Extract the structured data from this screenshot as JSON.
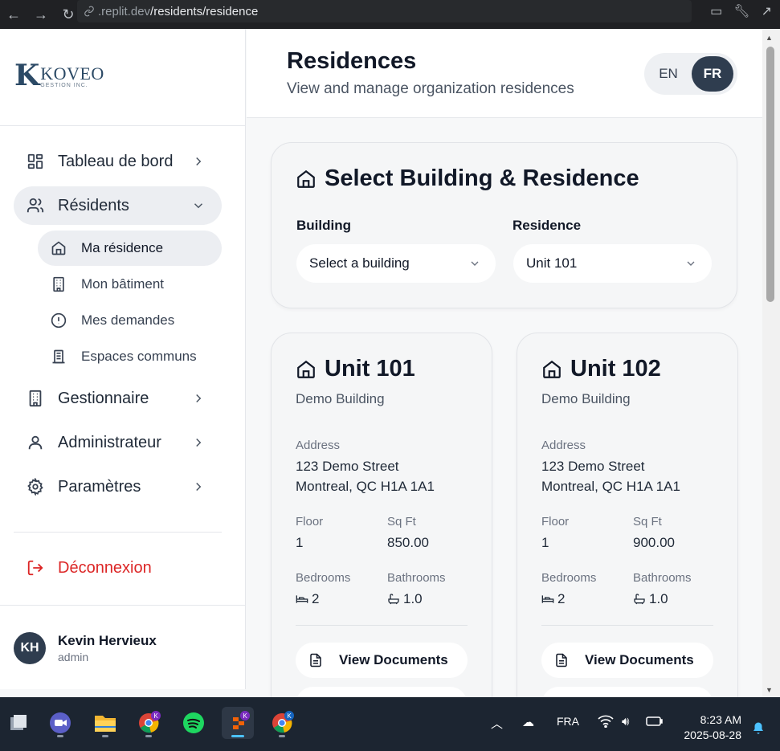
{
  "browser": {
    "url_host": ".replit.dev",
    "url_path": "/residents/residence"
  },
  "sidebar": {
    "logo": {
      "mark": "K",
      "name": "KOVEO",
      "sub": "GESTION INC."
    },
    "items": [
      {
        "label": "Tableau de bord",
        "icon": "dashboard-icon"
      },
      {
        "label": "Résidents",
        "icon": "users-icon"
      },
      {
        "label": "Gestionnaire",
        "icon": "building-icon"
      },
      {
        "label": "Administrateur",
        "icon": "user-icon"
      },
      {
        "label": "Paramètres",
        "icon": "gear-icon"
      }
    ],
    "sub_items": [
      {
        "label": "Ma résidence",
        "icon": "home-icon"
      },
      {
        "label": "Mon bâtiment",
        "icon": "building-icon"
      },
      {
        "label": "Mes demandes",
        "icon": "alert-circle-icon"
      },
      {
        "label": "Espaces communs",
        "icon": "library-icon"
      }
    ],
    "logout_label": "Déconnexion",
    "user": {
      "initials": "KH",
      "name": "Kevin Hervieux",
      "role": "admin"
    }
  },
  "header": {
    "title": "Residences",
    "subtitle": "View and manage organization residences",
    "lang_en": "EN",
    "lang_fr": "FR"
  },
  "selector": {
    "title": "Select Building & Residence",
    "building_label": "Building",
    "building_value": "Select a building",
    "residence_label": "Residence",
    "residence_value": "Unit 101"
  },
  "units": [
    {
      "name": "Unit 101",
      "building": "Demo Building",
      "address_label": "Address",
      "address_line1": "123 Demo Street",
      "address_line2": "Montreal, QC H1A 1A1",
      "floor_label": "Floor",
      "floor": "1",
      "sqft_label": "Sq Ft",
      "sqft": "850.00",
      "bedrooms_label": "Bedrooms",
      "bedrooms": "2",
      "bathrooms_label": "Bathrooms",
      "bathrooms": "1.0",
      "docs_label": "View Documents"
    },
    {
      "name": "Unit 102",
      "building": "Demo Building",
      "address_label": "Address",
      "address_line1": "123 Demo Street",
      "address_line2": "Montreal, QC H1A 1A1",
      "floor_label": "Floor",
      "floor": "1",
      "sqft_label": "Sq Ft",
      "sqft": "900.00",
      "bedrooms_label": "Bedrooms",
      "bedrooms": "2",
      "bathrooms_label": "Bathrooms",
      "bathrooms": "1.0",
      "docs_label": "View Documents"
    }
  ],
  "taskbar": {
    "language": "FRA",
    "time": "8:23 AM",
    "date": "2025-08-28"
  },
  "colors": {
    "accent_dark": "#2f3d4f",
    "logout_red": "#dc2626",
    "logo_blue": "#2c4a66"
  }
}
